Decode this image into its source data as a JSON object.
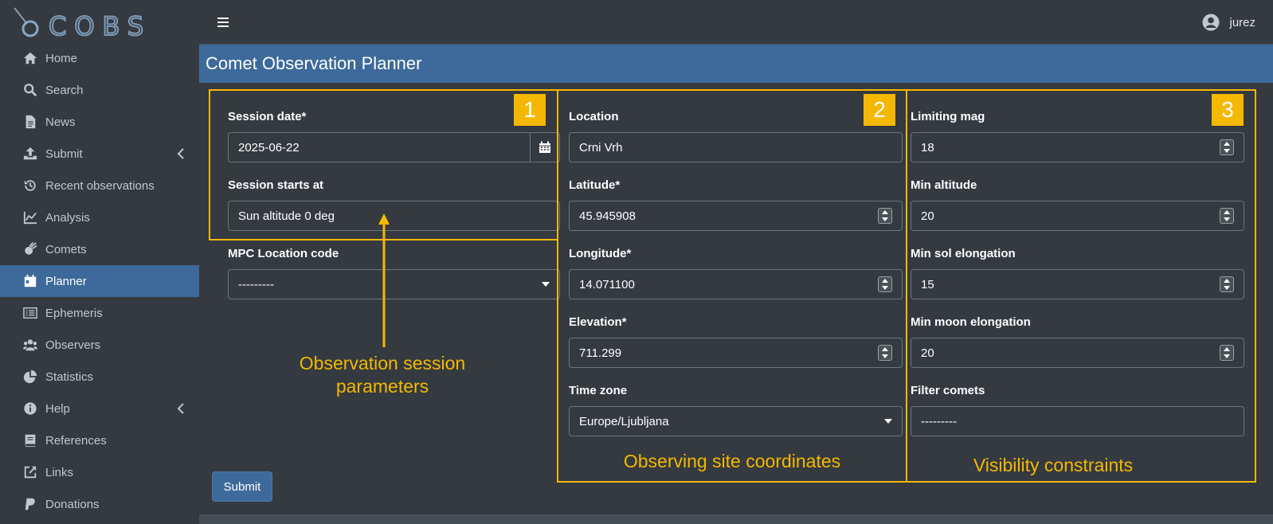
{
  "brand": {
    "name": "COBS"
  },
  "sidebar": {
    "items": [
      {
        "label": "Home",
        "icon": "home-icon"
      },
      {
        "label": "Search",
        "icon": "search-icon"
      },
      {
        "label": "News",
        "icon": "document-icon"
      },
      {
        "label": "Submit",
        "icon": "upload-icon",
        "has_submenu": true
      },
      {
        "label": "Recent observations",
        "icon": "history-icon"
      },
      {
        "label": "Analysis",
        "icon": "line-chart-icon"
      },
      {
        "label": "Comets",
        "icon": "comet-icon"
      },
      {
        "label": "Planner",
        "icon": "calendar-icon",
        "active": true
      },
      {
        "label": "Ephemeris",
        "icon": "list-icon"
      },
      {
        "label": "Observers",
        "icon": "users-icon"
      },
      {
        "label": "Statistics",
        "icon": "pie-chart-icon"
      },
      {
        "label": "Help",
        "icon": "info-icon",
        "has_submenu": true
      },
      {
        "label": "References",
        "icon": "book-icon"
      },
      {
        "label": "Links",
        "icon": "external-link-icon"
      },
      {
        "label": "Donations",
        "icon": "paypal-icon"
      }
    ]
  },
  "topbar": {
    "user": "jurez"
  },
  "page": {
    "title": "Comet Observation Planner"
  },
  "form": {
    "session_date": {
      "label": "Session date*",
      "value": "2025-06-22"
    },
    "session_start": {
      "label": "Session starts at",
      "value": "Sun altitude 0 deg"
    },
    "mpc_code": {
      "label": "MPC Location code",
      "value": "---------"
    },
    "location": {
      "label": "Location",
      "value": "Crni Vrh"
    },
    "latitude": {
      "label": "Latitude*",
      "value": "45.945908"
    },
    "longitude": {
      "label": "Longitude*",
      "value": "14.071100"
    },
    "elevation": {
      "label": "Elevation*",
      "value": "711.299"
    },
    "timezone": {
      "label": "Time zone",
      "value": "Europe/Ljubljana"
    },
    "limiting_mag": {
      "label": "Limiting mag",
      "value": "18"
    },
    "min_altitude": {
      "label": "Min altitude",
      "value": "20"
    },
    "min_sol_elongation": {
      "label": "Min sol elongation",
      "value": "15"
    },
    "min_moon_elongation": {
      "label": "Min moon elongation",
      "value": "20"
    },
    "filter_comets": {
      "label": "Filter comets",
      "value": "---------"
    },
    "submit_label": "Submit"
  },
  "annotations": {
    "badge1": "1",
    "badge2": "2",
    "badge3": "3",
    "session_line1": "Observation session",
    "session_line2": "parameters",
    "site": "Observing site coordinates",
    "visibility": "Visibility constraints"
  },
  "colors": {
    "accent": "#3d6a9a",
    "annotation": "#f5b800",
    "background": "#343a40"
  }
}
